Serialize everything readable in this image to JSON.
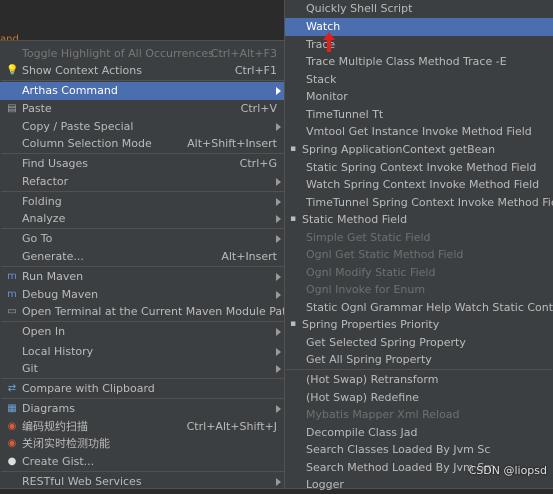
{
  "editor": {
    "fragment": "and Job"
  },
  "context_menu": {
    "items": [
      {
        "label": "Toggle Highlight of All Occurrences",
        "shortcut": "Ctrl+Alt+F3",
        "disabled": true,
        "icon": ""
      },
      {
        "label": "Show Context Actions",
        "shortcut": "Ctrl+F1",
        "icon": "bulb-icon"
      },
      {
        "label": "Arthas Command",
        "shortcut": "",
        "submenu": true,
        "selected": true
      },
      {
        "label": "Paste",
        "shortcut": "Ctrl+V",
        "icon": "paste-icon"
      },
      {
        "label": "Copy / Paste Special",
        "shortcut": "",
        "submenu": true
      },
      {
        "label": "Column Selection Mode",
        "shortcut": "Alt+Shift+Insert"
      },
      {
        "label": "Find Usages",
        "shortcut": "Ctrl+G"
      },
      {
        "label": "Refactor",
        "shortcut": "",
        "submenu": true
      },
      {
        "label": "Folding",
        "shortcut": "",
        "submenu": true
      },
      {
        "label": "Analyze",
        "shortcut": "",
        "submenu": true
      },
      {
        "label": "Go To",
        "shortcut": "",
        "submenu": true
      },
      {
        "label": "Generate...",
        "shortcut": "Alt+Insert"
      },
      {
        "label": "Run Maven",
        "shortcut": "",
        "submenu": true,
        "icon": "maven-run-icon"
      },
      {
        "label": "Debug Maven",
        "shortcut": "",
        "submenu": true,
        "icon": "maven-debug-icon"
      },
      {
        "label": "Open Terminal at the Current Maven Module Path",
        "shortcut": "",
        "icon": "terminal-icon"
      },
      {
        "label": "Open In",
        "shortcut": "",
        "submenu": true
      },
      {
        "label": "Local History",
        "shortcut": "",
        "submenu": true
      },
      {
        "label": "Git",
        "shortcut": "",
        "submenu": true
      },
      {
        "label": "Compare with Clipboard",
        "shortcut": "",
        "icon": "compare-icon"
      },
      {
        "label": "Diagrams",
        "shortcut": "",
        "submenu": true,
        "icon": "diagram-icon"
      },
      {
        "label": "编码规约扫描",
        "shortcut": "Ctrl+Alt+Shift+J",
        "icon": "scan-icon"
      },
      {
        "label": "关闭实时检测功能",
        "shortcut": "",
        "icon": "detect-icon"
      },
      {
        "label": "Create Gist...",
        "shortcut": "",
        "icon": "github-icon"
      },
      {
        "label": "RESTful Web Services",
        "shortcut": "",
        "submenu": true
      }
    ]
  },
  "arthas_submenu": {
    "items": [
      {
        "label": "Quickly Shell Script"
      },
      {
        "label": "Watch",
        "selected": true
      },
      {
        "label": "Trace"
      },
      {
        "label": "Trace Multiple Class Method Trace -E"
      },
      {
        "label": "Stack"
      },
      {
        "label": "Monitor"
      },
      {
        "label": "TimeTunnel Tt"
      },
      {
        "label": "Vmtool Get Instance Invoke Method Field"
      },
      {
        "label": "Spring ApplicationContext getBean",
        "bullet": true
      },
      {
        "label": "Static Spring Context Invoke  Method Field"
      },
      {
        "label": "Watch Spring Context Invoke Method Field"
      },
      {
        "label": "TimeTunnel Spring Context Invoke Method Field"
      },
      {
        "label": "Static Method Field",
        "bullet": true
      },
      {
        "label": "Simple Get Static Field",
        "disabled": true
      },
      {
        "label": "Ognl Get Static Method Field",
        "disabled": true
      },
      {
        "label": "Ognl Modify Static Field",
        "disabled": true
      },
      {
        "label": "Ognl Invoke for Enum",
        "disabled": true
      },
      {
        "label": "Static Ognl Grammar Help Watch Static Content"
      },
      {
        "label": "Spring Properties Priority",
        "bullet": true
      },
      {
        "label": "Get Selected Spring Property"
      },
      {
        "label": "Get All Spring Property"
      },
      {
        "label": "(Hot Swap) Retransform"
      },
      {
        "label": "(Hot Swap) Redefine"
      },
      {
        "label": "Mybatis Mapper Xml Reload",
        "disabled": true
      },
      {
        "label": "Decompile Class Jad"
      },
      {
        "label": "Search Classes Loaded By Jvm Sc"
      },
      {
        "label": "Search Method Loaded By Jvm Sm"
      },
      {
        "label": "Logger"
      }
    ]
  },
  "watermark": "CSDN @liopsd",
  "colors": {
    "menu_bg": "#3c3f41",
    "selection": "#4b6eaf",
    "text": "#bbbbbb",
    "disabled": "#777777"
  }
}
